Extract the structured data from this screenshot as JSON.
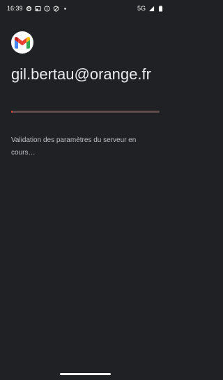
{
  "status_bar": {
    "time": "16:39",
    "network": "5G"
  },
  "account": {
    "email": "gil.bertau@orange.fr"
  },
  "progress": {
    "fraction": 0.01,
    "track_color": "#5f4b4b",
    "fill_color": "#ea4335"
  },
  "message": "Validation des paramètres du serveur en cours…",
  "icons": {
    "status_left": [
      "gear-icon",
      "cast-icon",
      "info-icon",
      "shield-icon",
      "dot-icon"
    ],
    "status_right": [
      "signal-icon",
      "battery-icon"
    ],
    "app_logo": "gmail-logo-icon"
  },
  "colors": {
    "background": "#202124",
    "gmail_red": "#ea4335",
    "gmail_blue": "#4285f4",
    "gmail_green": "#34a853",
    "gmail_yellow": "#fbbc04"
  }
}
